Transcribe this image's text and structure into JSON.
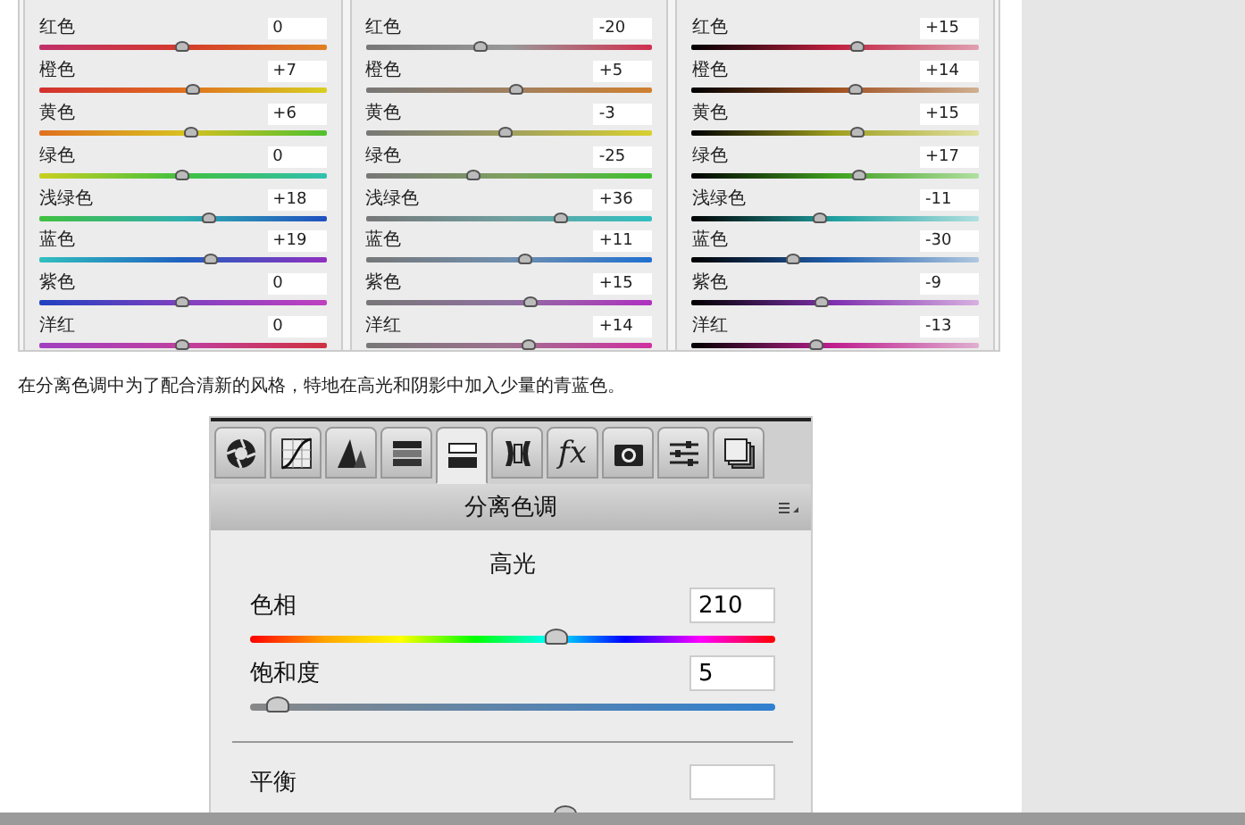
{
  "hsl_panels": [
    {
      "rows": [
        {
          "label": "红色",
          "value": "0",
          "level": 0.5
        },
        {
          "label": "橙色",
          "value": "+7",
          "level": 0.535
        },
        {
          "label": "黄色",
          "value": "+6",
          "level": 0.53
        },
        {
          "label": "绿色",
          "value": "0",
          "level": 0.5
        },
        {
          "label": "浅绿色",
          "value": "+18",
          "level": 0.59
        },
        {
          "label": "蓝色",
          "value": "+19",
          "level": 0.595
        },
        {
          "label": "紫色",
          "value": "0",
          "level": 0.5
        },
        {
          "label": "洋红",
          "value": "0",
          "level": 0.5
        }
      ]
    },
    {
      "rows": [
        {
          "label": "红色",
          "value": "-20",
          "level": 0.4
        },
        {
          "label": "橙色",
          "value": "+5",
          "level": 0.525
        },
        {
          "label": "黄色",
          "value": "-3",
          "level": 0.485
        },
        {
          "label": "绿色",
          "value": "-25",
          "level": 0.375
        },
        {
          "label": "浅绿色",
          "value": "+36",
          "level": 0.68
        },
        {
          "label": "蓝色",
          "value": "+11",
          "level": 0.555
        },
        {
          "label": "紫色",
          "value": "+15",
          "level": 0.575
        },
        {
          "label": "洋红",
          "value": "+14",
          "level": 0.57
        }
      ]
    },
    {
      "rows": [
        {
          "label": "红色",
          "value": "+15",
          "level": 0.575
        },
        {
          "label": "橙色",
          "value": "+14",
          "level": 0.57
        },
        {
          "label": "黄色",
          "value": "+15",
          "level": 0.575
        },
        {
          "label": "绿色",
          "value": "+17",
          "level": 0.585
        },
        {
          "label": "浅绿色",
          "value": "-11",
          "level": 0.445
        },
        {
          "label": "蓝色",
          "value": "-30",
          "level": 0.35
        },
        {
          "label": "紫色",
          "value": "-9",
          "level": 0.455
        },
        {
          "label": "洋红",
          "value": "-13",
          "level": 0.435
        }
      ]
    }
  ],
  "paragraph": "在分离色调中为了配合清新的风格，特地在高光和阴影中加入少量的青蓝色。",
  "split_toning": {
    "tabs": [
      {
        "kind": "aperture",
        "selected": false
      },
      {
        "kind": "curve",
        "selected": false
      },
      {
        "kind": "detail",
        "selected": false
      },
      {
        "kind": "hsl",
        "selected": false
      },
      {
        "kind": "split",
        "selected": true
      },
      {
        "kind": "lens",
        "selected": false
      },
      {
        "kind": "fx",
        "text": "fx",
        "selected": false
      },
      {
        "kind": "camera",
        "selected": false
      },
      {
        "kind": "presets",
        "selected": false
      },
      {
        "kind": "snapshots",
        "selected": false
      }
    ],
    "title": "分离色调",
    "section": "高光",
    "sliders": [
      {
        "kind": "hue",
        "label": "色相",
        "value": "210",
        "level": 0.583
      },
      {
        "kind": "saturation",
        "label": "饱和度",
        "value": "5",
        "level": 0.05
      }
    ],
    "balance": {
      "label": "平衡",
      "level": 0.6
    }
  }
}
